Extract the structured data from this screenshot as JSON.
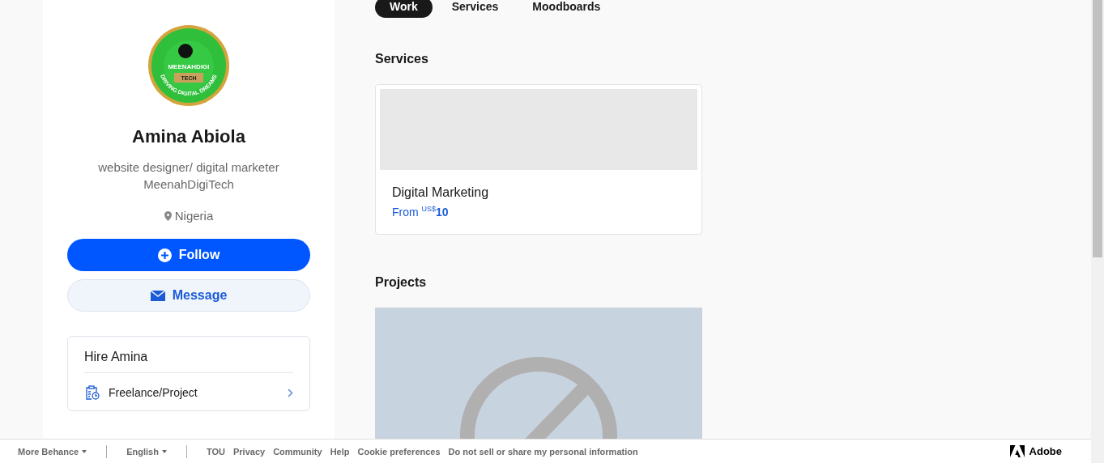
{
  "logo": {
    "name": "MEENAHDIGI",
    "tag": "TECH",
    "motto": "DRIVING DIGITAL DREAMS"
  },
  "profile": {
    "name": "Amina Abiola",
    "bio": [
      "website designer/ digital marketer",
      "MeenahDigiTech"
    ],
    "location": "Nigeria"
  },
  "actions": [
    {
      "kind": "follow",
      "label": "Follow"
    },
    {
      "kind": "message",
      "label": "Message"
    }
  ],
  "hire": {
    "title": "Hire Amina",
    "options": [
      {
        "label": "Freelance/Project"
      }
    ]
  },
  "tabs": [
    {
      "label": "Work",
      "selected": true
    },
    {
      "label": "Services",
      "selected": false
    },
    {
      "label": "Moodboards",
      "selected": false
    }
  ],
  "services": {
    "heading": "Services",
    "items": [
      {
        "title": "Digital Marketing",
        "from": "From",
        "currency": "US$",
        "amount": "10"
      }
    ]
  },
  "projects": {
    "heading": "Projects"
  },
  "footer": {
    "menus": [
      {
        "label": "More Behance"
      },
      {
        "label": "English"
      }
    ],
    "links": [
      "TOU",
      "Privacy",
      "Community",
      "Help",
      "Cookie preferences",
      "Do not sell or share my personal information"
    ],
    "brand": "Adobe"
  }
}
